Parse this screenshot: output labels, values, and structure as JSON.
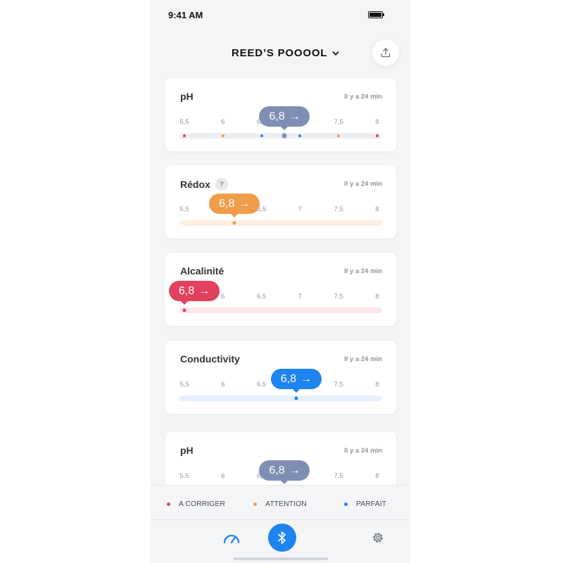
{
  "status": {
    "time": "9:41 AM",
    "battery": "full"
  },
  "header": {
    "pool_name": "REED’S POOOOL",
    "dropdown_icon": "chevron-down-icon",
    "share_icon": "share-icon"
  },
  "colors": {
    "a_corriger": "#e2415f",
    "attention": "#f09d4b",
    "parfait": "#1e84f0",
    "neutral": "#7f8fb4",
    "background": "#f4f5f7"
  },
  "cards": [
    {
      "title": "pH",
      "help": false,
      "time": "Il y a 24 min",
      "status": "neutral",
      "value": "6,8",
      "arrow": "→",
      "level": 6.8,
      "ticks": [
        {
          "label": "5,5",
          "v": 5.5
        },
        {
          "label": "6",
          "v": 6.0
        },
        {
          "label": "6,5",
          "v": 6.5
        },
        {
          "label": "7",
          "v": 7.0
        },
        {
          "label": "7,5",
          "v": 7.5
        },
        {
          "label": "8",
          "v": 8.0
        }
      ],
      "zones": [
        {
          "status": "a_corriger",
          "v": 5.5
        },
        {
          "status": "attention",
          "v": 6.0
        },
        {
          "status": "parfait",
          "v": 6.5
        },
        {
          "status": "parfait",
          "v": 7.0
        },
        {
          "status": "attention",
          "v": 7.5
        },
        {
          "status": "a_corriger",
          "v": 8.0
        }
      ]
    },
    {
      "title": "Rédox",
      "help": true,
      "help_label": "?",
      "time": "Il y a 24 min",
      "status": "attention",
      "value": "6,8",
      "arrow": "→",
      "level": 6.15,
      "ticks": [
        {
          "label": "5,5",
          "v": 5.5
        },
        {
          "label": "6,5",
          "v": 6.5
        },
        {
          "label": "7",
          "v": 7.0
        },
        {
          "label": "7,5",
          "v": 7.5
        },
        {
          "label": "8",
          "v": 8.0
        }
      ],
      "zones": []
    },
    {
      "title": "Alcalinité",
      "help": false,
      "time": "Il y a 24 min",
      "status": "a_corriger",
      "value": "6,8",
      "arrow": "→",
      "level": 5.5,
      "ticks": [
        {
          "label": "6",
          "v": 6.0
        },
        {
          "label": "6,5",
          "v": 6.5
        },
        {
          "label": "7",
          "v": 7.0
        },
        {
          "label": "7,5",
          "v": 7.5
        },
        {
          "label": "8",
          "v": 8.0
        }
      ],
      "zones": []
    },
    {
      "title": "Conductivity",
      "help": false,
      "time": "Il y a 24 min",
      "status": "parfait",
      "value": "6,8",
      "arrow": "→",
      "level": 6.95,
      "ticks": [
        {
          "label": "5,5",
          "v": 5.5
        },
        {
          "label": "6",
          "v": 6.0
        },
        {
          "label": "6,5",
          "v": 6.5
        },
        {
          "label": "7,5",
          "v": 7.5
        },
        {
          "label": "8",
          "v": 8.0
        }
      ],
      "zones": []
    },
    {
      "title": "pH",
      "help": false,
      "time": "Il y a 24 min",
      "status": "neutral",
      "value": "6,8",
      "arrow": "→",
      "level": 6.8,
      "ticks": [
        {
          "label": "5,5",
          "v": 5.5
        },
        {
          "label": "6",
          "v": 6.0
        },
        {
          "label": "6,5",
          "v": 6.5
        },
        {
          "label": "7,5",
          "v": 7.5
        },
        {
          "label": "8",
          "v": 8.0
        }
      ],
      "zones": []
    }
  ],
  "legend": [
    {
      "label": "A CORRIGER",
      "status": "a_corriger"
    },
    {
      "label": "ATTENTION",
      "status": "attention"
    },
    {
      "label": "PARFAIT",
      "status": "parfait"
    }
  ],
  "tabbar": {
    "left_icon": "gauge-icon",
    "center_icon": "bluetooth-icon",
    "right_icon": "settings-icon"
  }
}
